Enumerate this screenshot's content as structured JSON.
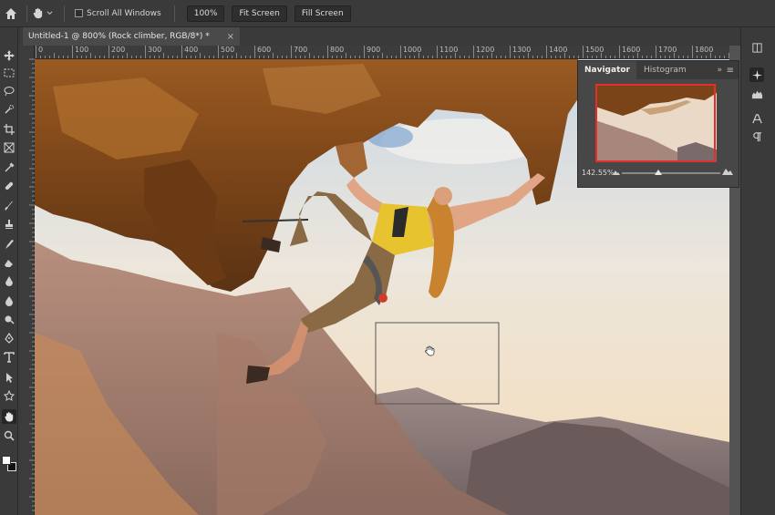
{
  "options_bar": {
    "scroll_all_windows": "Scroll All Windows",
    "zoom_100": "100%",
    "fit_screen": "Fit Screen",
    "fill_screen": "Fill Screen"
  },
  "document": {
    "tab_title": "Untitled-1 @ 800% (Rock climber, RGB/8*) *",
    "close": "×"
  },
  "ruler": {
    "ticks": [
      "0",
      "100",
      "200",
      "300",
      "400",
      "500",
      "600",
      "700",
      "800",
      "900",
      "1000",
      "1100",
      "1200",
      "1300",
      "1400",
      "1500",
      "1600",
      "1700",
      "1800"
    ]
  },
  "navigator": {
    "tab_navigator": "Navigator",
    "tab_histogram": "Histogram",
    "collapse": "»",
    "menu": "≡",
    "zoom_value": "142.55%",
    "zoom_slider_fraction": 0.37
  },
  "colors": {
    "app_bg": "#535353",
    "panel_bg": "#3a3a3a",
    "nav_view_box": "#e0302c"
  },
  "toolbar": {
    "tools": [
      "move-icon",
      "marquee-icon",
      "lasso-icon",
      "quick-select-icon",
      "crop-icon",
      "frame-icon",
      "eyedropper-icon",
      "healing-icon",
      "brush-icon",
      "stamp-icon",
      "history-brush-icon",
      "eraser-icon",
      "gradient-icon",
      "blur-icon",
      "dodge-icon",
      "pen-icon",
      "type-icon",
      "path-select-icon",
      "shape-icon",
      "hand-icon",
      "zoom-icon"
    ],
    "active": "hand-icon"
  }
}
